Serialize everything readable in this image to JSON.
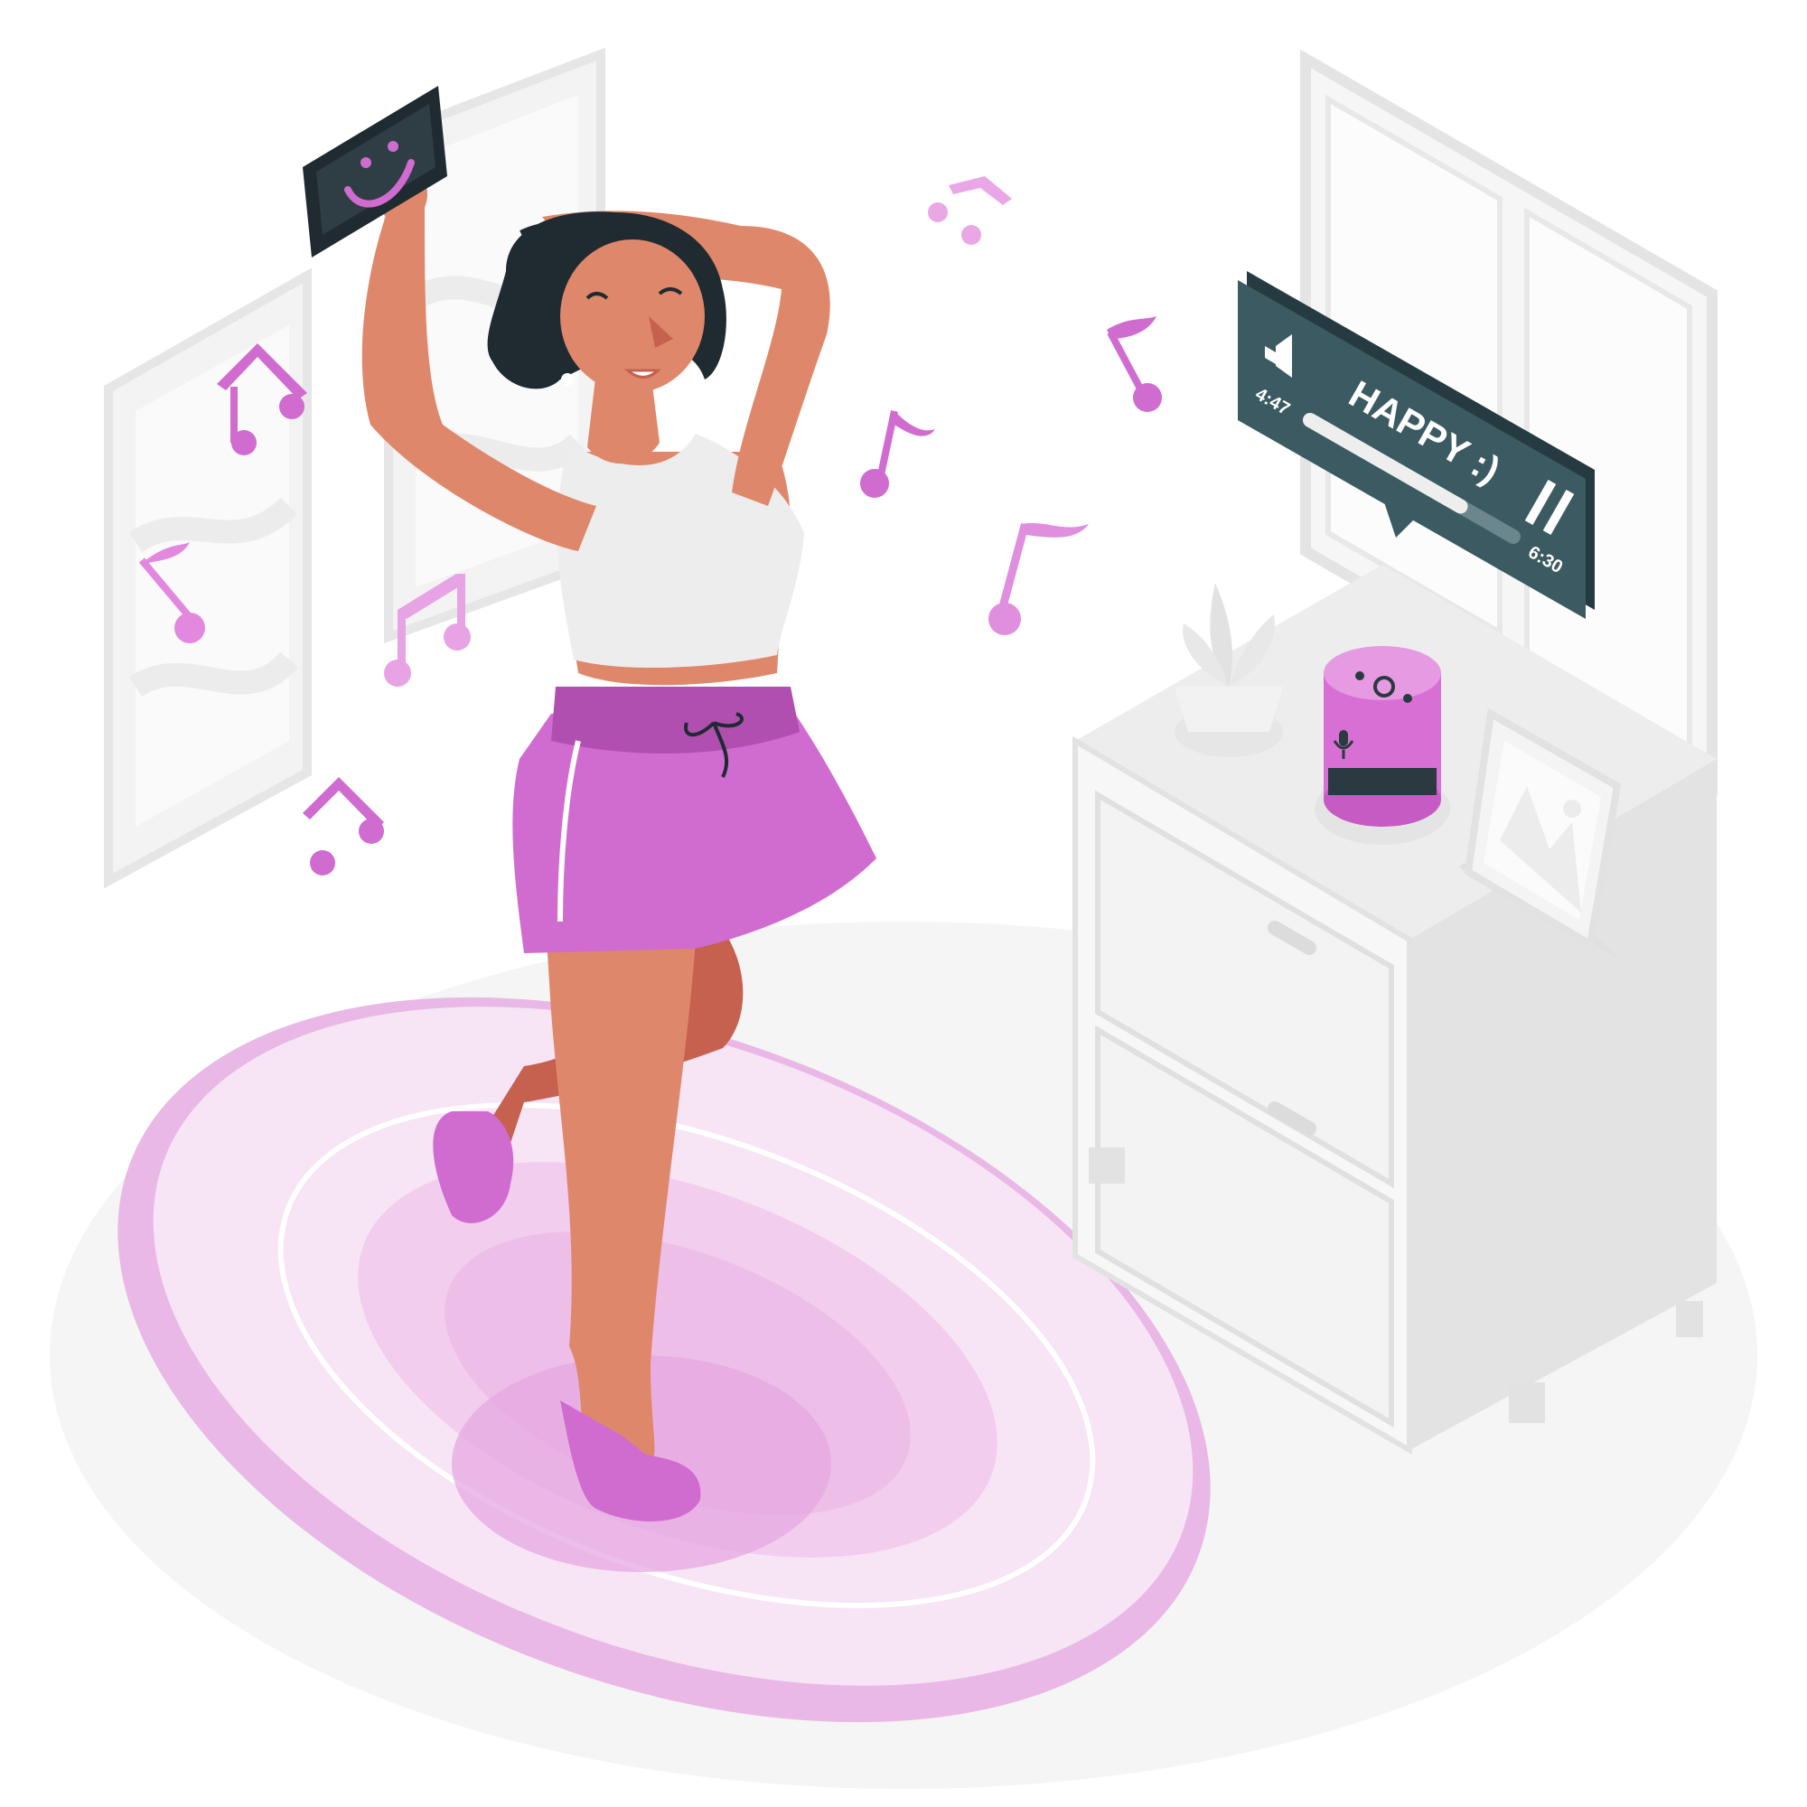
{
  "colors": {
    "accent": "#d06bd0",
    "accent_dark": "#b04fb0",
    "accent_light": "#e9a8e6",
    "skin": "#df876b",
    "skin_shadow": "#c6604f",
    "hair": "#1f2a31",
    "screen_panel": "#3b5a62",
    "white_furniture": "#f5f5f5",
    "furniture_shadow": "#e3e3e3"
  },
  "player": {
    "title": "HAPPY :)",
    "elapsed": "4:47",
    "duration": "6:30",
    "progress": 0.74,
    "volume_icon": "speaker-icon",
    "pause_icon": "pause-icon"
  },
  "phone": {
    "screen_icon": "smiley-icon"
  },
  "speaker": {
    "mic_icon": "microphone-icon",
    "power_icon": "power-icon"
  },
  "decor": {
    "note_icon": "music-note-icon",
    "plant_icon": "plant-icon",
    "frame_icon": "picture-frame-icon"
  }
}
